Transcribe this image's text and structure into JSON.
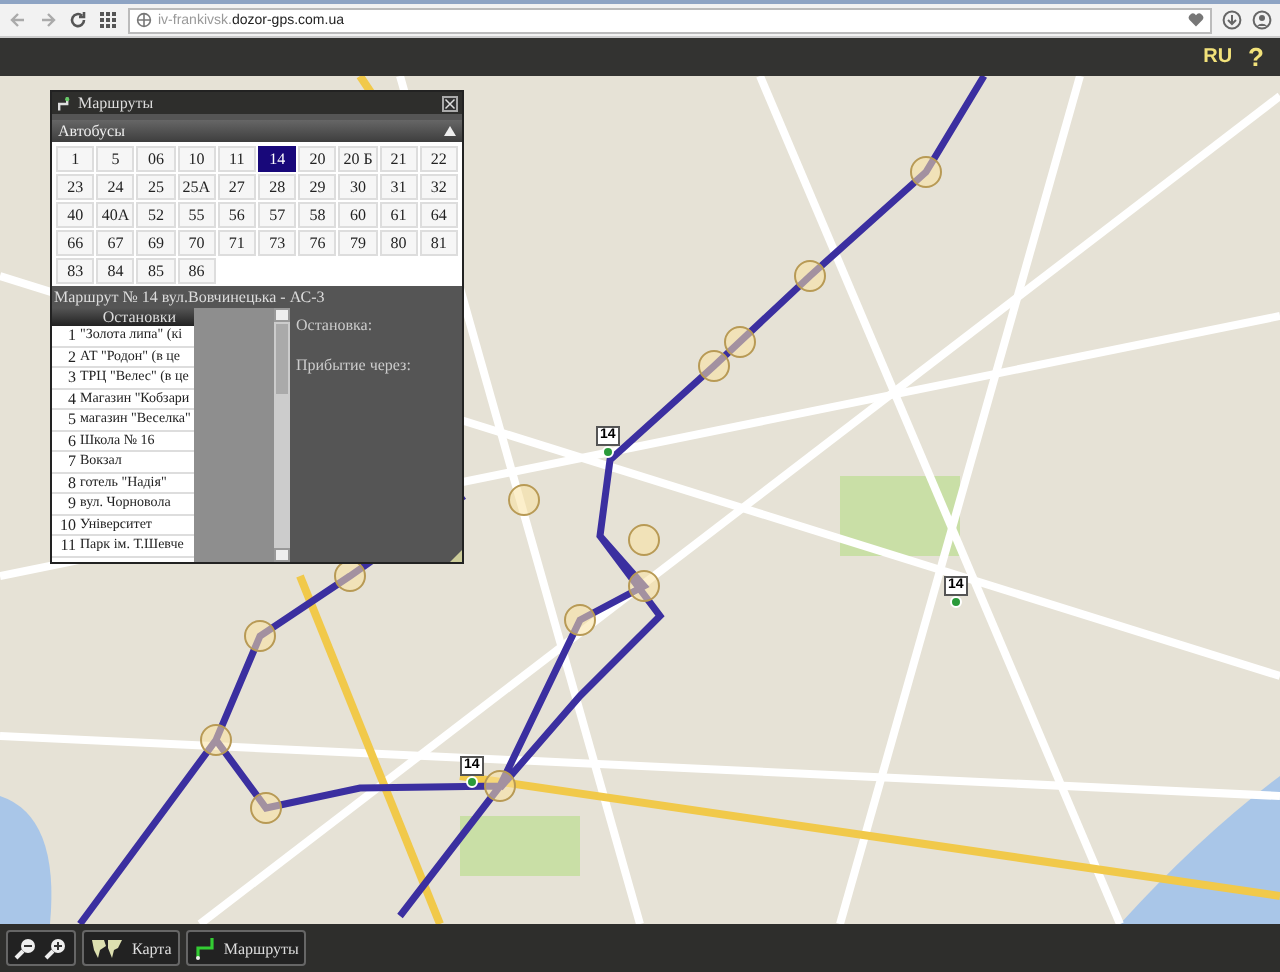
{
  "browser": {
    "url_prefix": "iv-frankivsk.",
    "url_domain": "dozor-gps.com.ua"
  },
  "header": {
    "language": "RU",
    "help": "?"
  },
  "panel": {
    "title": "Маршруты",
    "section": "Автобусы",
    "routes": [
      {
        "label": "1",
        "selected": false
      },
      {
        "label": "5",
        "selected": false
      },
      {
        "label": "06",
        "selected": false
      },
      {
        "label": "10",
        "selected": false
      },
      {
        "label": "11",
        "selected": false
      },
      {
        "label": "14",
        "selected": true
      },
      {
        "label": "20",
        "selected": false
      },
      {
        "label": "20 Б",
        "selected": false
      },
      {
        "label": "21",
        "selected": false
      },
      {
        "label": "22",
        "selected": false
      },
      {
        "label": "23",
        "selected": false
      },
      {
        "label": "24",
        "selected": false
      },
      {
        "label": "25",
        "selected": false
      },
      {
        "label": "25А",
        "selected": false
      },
      {
        "label": "27",
        "selected": false
      },
      {
        "label": "28",
        "selected": false
      },
      {
        "label": "29",
        "selected": false
      },
      {
        "label": "30",
        "selected": false
      },
      {
        "label": "31",
        "selected": false
      },
      {
        "label": "32",
        "selected": false
      },
      {
        "label": "40",
        "selected": false
      },
      {
        "label": "40А",
        "selected": false
      },
      {
        "label": "52",
        "selected": false
      },
      {
        "label": "55",
        "selected": false
      },
      {
        "label": "56",
        "selected": false
      },
      {
        "label": "57",
        "selected": false
      },
      {
        "label": "58",
        "selected": false
      },
      {
        "label": "60",
        "selected": false
      },
      {
        "label": "61",
        "selected": false
      },
      {
        "label": "64",
        "selected": false
      },
      {
        "label": "66",
        "selected": false
      },
      {
        "label": "67",
        "selected": false
      },
      {
        "label": "69",
        "selected": false
      },
      {
        "label": "70",
        "selected": false
      },
      {
        "label": "71",
        "selected": false
      },
      {
        "label": "73",
        "selected": false
      },
      {
        "label": "76",
        "selected": false
      },
      {
        "label": "79",
        "selected": false
      },
      {
        "label": "80",
        "selected": false
      },
      {
        "label": "81",
        "selected": false
      },
      {
        "label": "83",
        "selected": false
      },
      {
        "label": "84",
        "selected": false
      },
      {
        "label": "85",
        "selected": false
      },
      {
        "label": "86",
        "selected": false
      }
    ],
    "route_title": "Маршрут № 14 вул.Вовчинецька - АС-3",
    "stops_header": "Остановки",
    "stops": [
      {
        "number": "1",
        "name": "\"Золота липа\" (кі"
      },
      {
        "number": "2",
        "name": "АТ \"Родон\" (в це"
      },
      {
        "number": "3",
        "name": "ТРЦ \"Велес\" (в це"
      },
      {
        "number": "4",
        "name": "Магазин \"Кобзари"
      },
      {
        "number": "5",
        "name": "магазин \"Веселка\""
      },
      {
        "number": "6",
        "name": "Школа № 16"
      },
      {
        "number": "7",
        "name": "Вокзал"
      },
      {
        "number": "8",
        "name": "готель \"Надія\""
      },
      {
        "number": "9",
        "name": "вул. Чорновола"
      },
      {
        "number": "10",
        "name": "Університет"
      },
      {
        "number": "11",
        "name": "Парк ім. Т.Шевче"
      }
    ],
    "stop_label": "Остановка:",
    "arrival_label": "Прибытие через:"
  },
  "map": {
    "markers": [
      {
        "label": "14"
      },
      {
        "label": "14"
      },
      {
        "label": "14"
      }
    ]
  },
  "bottom_bar": {
    "buttons": [
      {
        "kind": "zoom-out"
      },
      {
        "kind": "zoom-in"
      },
      {
        "kind": "map",
        "label": "Карта"
      },
      {
        "kind": "routes",
        "label": "Маршруты"
      }
    ]
  }
}
